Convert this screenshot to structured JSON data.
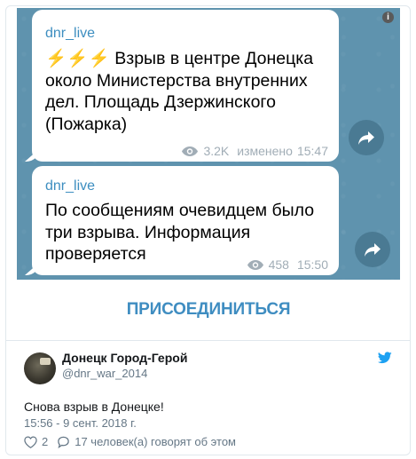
{
  "telegram": {
    "messages": [
      {
        "author": "dnr_live",
        "text": "⚡⚡⚡ Взрыв в центре Донецка около Министерства внутренних дел. Площадь Дзержинского (Пожарка)",
        "views": "3.2K",
        "edited_label": "изменено",
        "time": "15:47"
      },
      {
        "author": "dnr_live",
        "text": "По сообщениям очевидцем было три взрыва. Информация проверяется",
        "views": "458",
        "time": "15:50"
      }
    ],
    "join_label": "ПРИСОЕДИНИТЬСЯ",
    "info_label": "i"
  },
  "tweet": {
    "display_name": "Донецк Город-Герой",
    "handle": "@dnr_war_2014",
    "text": "Снова взрыв в Донецке!",
    "timestamp": "15:56 - 9 сент. 2018 г.",
    "likes": "2",
    "replies_text": "17 человек(а) говорят об этом"
  },
  "colors": {
    "telegram_bg": "#5f93ae",
    "link_blue": "#3d8ec0",
    "twitter_blue": "#1da1f2",
    "meta_gray": "#a1adb6"
  },
  "icons": [
    "info-icon",
    "eye-icon",
    "share-icon",
    "twitter-bird-icon",
    "heart-icon",
    "reply-bubble-icon"
  ]
}
